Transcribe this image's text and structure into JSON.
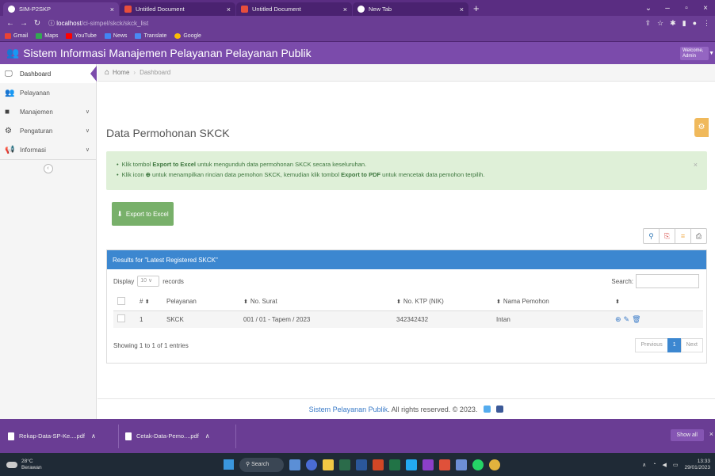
{
  "browser": {
    "tabs": [
      {
        "title": "SIM-P2SKP",
        "active": true
      },
      {
        "title": "Untitled Document",
        "active": false
      },
      {
        "title": "Untitled Document",
        "active": false
      },
      {
        "title": "New Tab",
        "active": false
      }
    ],
    "url_host": "localhost",
    "url_path": "/ci-simpel/skck/skck_list",
    "bookmarks": [
      "Gmail",
      "Maps",
      "YouTube",
      "News",
      "Translate",
      "Google"
    ]
  },
  "app": {
    "title": "Sistem Informasi Manajemen Pelayanan Pelayanan Publik",
    "welcome_line1": "Welcome,",
    "welcome_line2": "Admin"
  },
  "sidebar": {
    "items": [
      {
        "label": "Dashboard",
        "icon": "monitor-icon"
      },
      {
        "label": "Pelayanan",
        "icon": "users-icon"
      },
      {
        "label": "Manajemen",
        "icon": "folder-icon"
      },
      {
        "label": "Pengaturan",
        "icon": "gears-icon"
      },
      {
        "label": "Informasi",
        "icon": "bullhorn-icon"
      }
    ]
  },
  "breadcrumb": {
    "home": "Home",
    "current": "Dashboard"
  },
  "page": {
    "title": "Data Permohonan SKCK",
    "alert_1_pre": "Klik tombol ",
    "alert_1_bold": "Export to Excel",
    "alert_1_post": " untuk mengunduh data permohonan SKCK secara keseluruhan.",
    "alert_2_pre": "Klik icon ",
    "alert_2_mid": " untuk menampilkan rincian data pemohon SKCK, kemudian klik tombol ",
    "alert_2_bold": "Export to PDF",
    "alert_2_post": " untuk mencetak data pemohon terpilih.",
    "export_label": "Export to Excel"
  },
  "table": {
    "panel_title": "Results for \"Latest Registered SKCK\"",
    "display_label": "Display",
    "display_value": "10",
    "records_label": "records",
    "search_label": "Search:",
    "columns": [
      "#",
      "Pelayanan",
      "No. Surat",
      "No. KTP (NIK)",
      "Nama Pemohon"
    ],
    "rows": [
      {
        "no": "1",
        "pelayanan": "SKCK",
        "no_surat": "001 / 01 - Tapem / 2023",
        "nik": "342342432",
        "nama": "Intan"
      }
    ],
    "info": "Showing 1 to 1 of 1 entries",
    "pager": {
      "prev": "Previous",
      "page": "1",
      "next": "Next"
    }
  },
  "footer": {
    "brand": "Sistem Pelayanan Publik",
    "text": ". All rights reserved. © 2023."
  },
  "downloads": {
    "items": [
      "Rekap-Data-SP-Ke....pdf",
      "Cetak-Data-Pemo....pdf"
    ],
    "show_all": "Show all"
  },
  "taskbar": {
    "temp": "28°C",
    "weather": "Berawan",
    "search": "Search",
    "time": "13:33",
    "date": "29/01/2023"
  }
}
